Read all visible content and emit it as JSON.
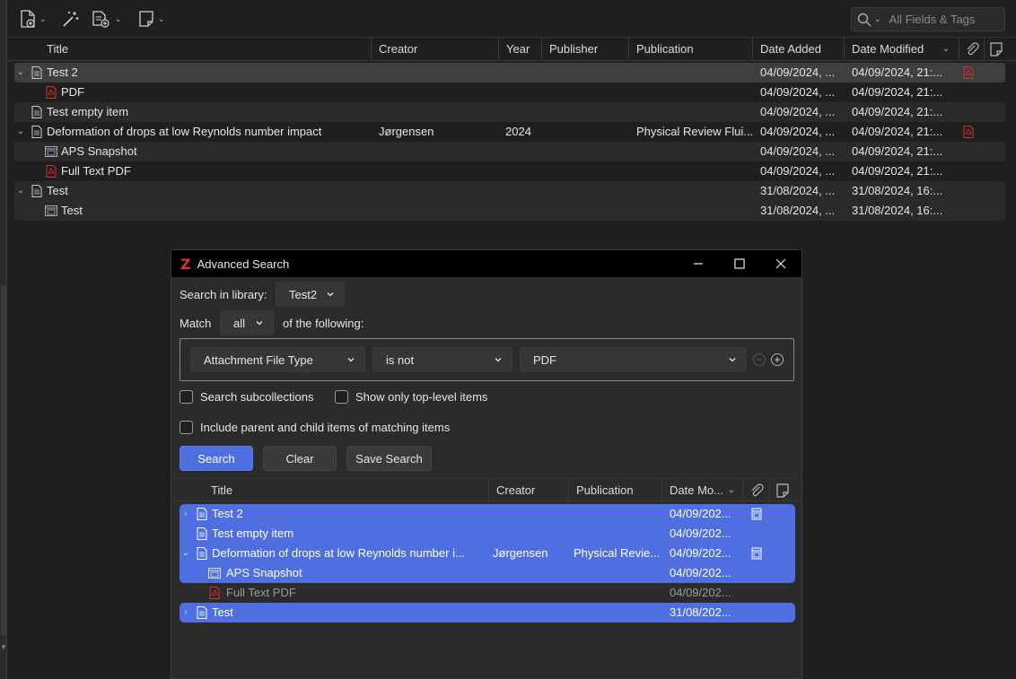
{
  "toolbar": {
    "new_item_icon": "new-item-icon",
    "magic_wand_icon": "magic-wand-icon",
    "add_attachment_icon": "add-attachment-icon",
    "new_note_icon": "new-note-icon",
    "search_placeholder": "All Fields & Tags"
  },
  "columns": {
    "title": "Title",
    "creator": "Creator",
    "year": "Year",
    "publisher": "Publisher",
    "publication": "Publication",
    "date_added": "Date Added",
    "date_modified": "Date Modified"
  },
  "rows": [
    {
      "title": "Test 2",
      "creator": "",
      "year": "",
      "publication": "",
      "date_added": "04/09/2024, ...",
      "date_modified": "04/09/2024, 21:...",
      "level": 0,
      "expanded": true,
      "has_pdf": true
    },
    {
      "title": "PDF",
      "creator": "",
      "year": "",
      "publication": "",
      "date_added": "04/09/2024, ...",
      "date_modified": "04/09/2024, 21:...",
      "level": 1
    },
    {
      "title": "Test empty item",
      "creator": "",
      "year": "",
      "publication": "",
      "date_added": "04/09/2024, ...",
      "date_modified": "04/09/2024, 21:...",
      "level": 0
    },
    {
      "title": "Deformation of drops at low Reynolds number impact",
      "creator": "Jørgensen",
      "year": "2024",
      "publication": "Physical Review Flui...",
      "date_added": "04/09/2024, ...",
      "date_modified": "04/09/2024, 21:...",
      "level": 0,
      "expanded": true,
      "has_pdf": true
    },
    {
      "title": "APS Snapshot",
      "creator": "",
      "year": "",
      "publication": "",
      "date_added": "04/09/2024, ...",
      "date_modified": "04/09/2024, 21:...",
      "level": 1
    },
    {
      "title": "Full Text PDF",
      "creator": "",
      "year": "",
      "publication": "",
      "date_added": "04/09/2024, ...",
      "date_modified": "04/09/2024, 21:...",
      "level": 1
    },
    {
      "title": "Test",
      "creator": "",
      "year": "",
      "publication": "",
      "date_added": "31/08/2024, ...",
      "date_modified": "31/08/2024, 16:...",
      "level": 0,
      "expanded": true
    },
    {
      "title": "Test",
      "creator": "",
      "year": "",
      "publication": "",
      "date_added": "31/08/2024, ...",
      "date_modified": "31/08/2024, 16:...",
      "level": 1
    }
  ],
  "dialog": {
    "title": "Advanced Search",
    "search_in_library_label": "Search in library:",
    "library_value": "Test2",
    "match_label": "Match",
    "match_value": "all",
    "of_following_label": "of the following:",
    "condition_field": "Attachment File Type",
    "condition_operator": "is not",
    "condition_value": "PDF",
    "cb_subcollections": "Search subcollections",
    "cb_top_level": "Show only top-level items",
    "cb_parent_child": "Include parent and child items of matching items",
    "search_button": "Search",
    "clear_button": "Clear",
    "save_search_button": "Save Search",
    "columns": {
      "title": "Title",
      "creator": "Creator",
      "publication": "Publication",
      "date_modified": "Date Mo..."
    },
    "results": [
      {
        "title": "Test 2",
        "creator": "",
        "publication": "",
        "date": "04/09/202...",
        "twisty": "›"
      },
      {
        "title": "Test empty item",
        "creator": "",
        "publication": "",
        "date": "04/09/202...",
        "twisty": ""
      },
      {
        "title": "Deformation of drops at low Reynolds number i...",
        "creator": "Jørgensen",
        "publication": "Physical Revie...",
        "date": "04/09/202...",
        "twisty": "⌄"
      },
      {
        "title": "APS Snapshot",
        "creator": "",
        "publication": "",
        "date": "04/09/202...",
        "twisty": ""
      },
      {
        "title": "Full Text PDF",
        "creator": "",
        "publication": "",
        "date": "04/09/202...",
        "twisty": ""
      },
      {
        "title": "Test",
        "creator": "",
        "publication": "",
        "date": "31/08/202...",
        "twisty": "›"
      }
    ]
  },
  "colors": {
    "accent": "#4f6fe0",
    "pdf_red": "#d8312b",
    "background": "#1f1f1f"
  }
}
